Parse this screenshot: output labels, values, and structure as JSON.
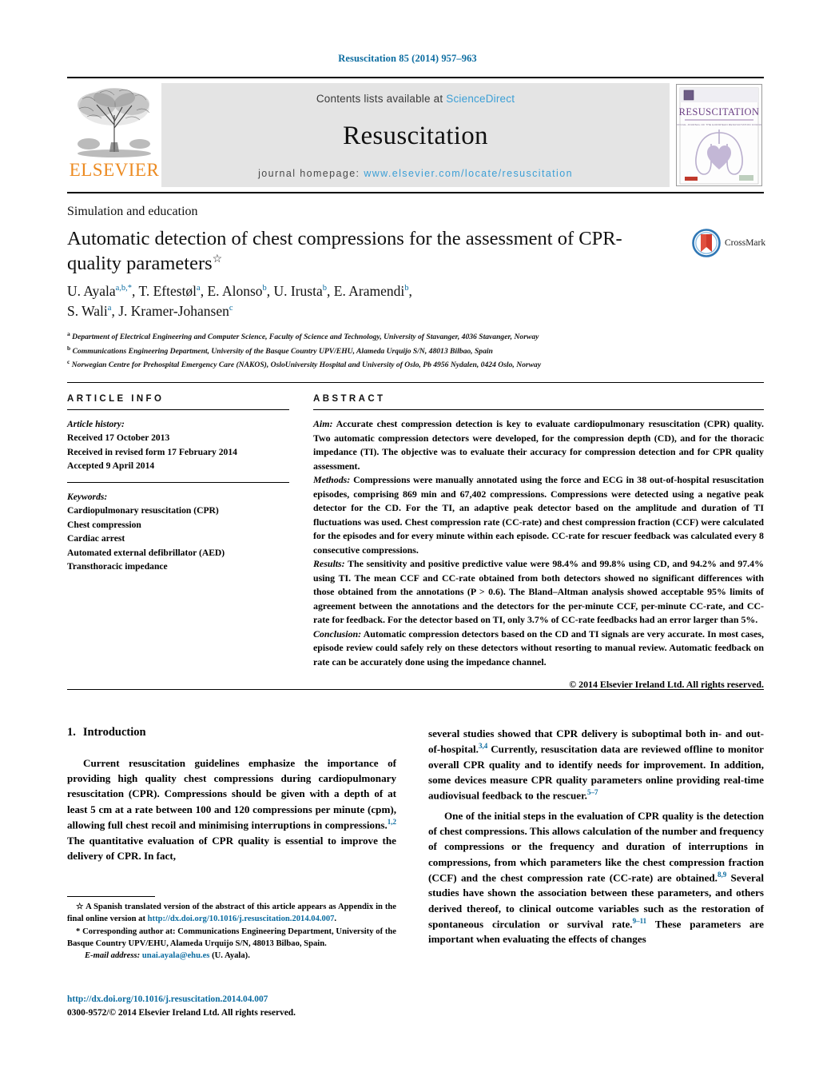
{
  "running_head": "Resuscitation 85 (2014) 957–963",
  "masthead": {
    "publisher_wordmark": "ELSEVIER",
    "contents_prefix": "Contents lists available at ",
    "contents_link": "ScienceDirect",
    "journal_name": "Resuscitation",
    "homepage_prefix": "journal homepage: ",
    "homepage_url": "www.elsevier.com/locate/resuscitation",
    "cover_title": "RESUSCITATION",
    "cover_subtitle": "OFFICIAL JOURNAL OF THE EUROPEAN RESUSCITATION COUNCIL",
    "link_color": "#3c9fd6",
    "band_color": "#e4e4e4",
    "elsevier_orange": "#ec8b22"
  },
  "article": {
    "section_label": "Simulation and education",
    "title": "Automatic detection of chest compressions for the assessment of CPR-quality parameters",
    "title_marker": "☆",
    "crossmark_label": "CrossMark",
    "authors_line1": "U. Ayala",
    "authors": [
      {
        "name": "U. Ayala",
        "sup": "a,b,*"
      },
      {
        "name": "T. Eftestøl",
        "sup": "a"
      },
      {
        "name": "E. Alonso",
        "sup": "b"
      },
      {
        "name": "U. Irusta",
        "sup": "b"
      },
      {
        "name": "E. Aramendi",
        "sup": "b"
      },
      {
        "name": "S. Wali",
        "sup": "a"
      },
      {
        "name": "J. Kramer-Johansen",
        "sup": "c"
      }
    ],
    "affiliations": [
      {
        "mark": "a",
        "text": "Department of Electrical Engineering and Computer Science, Faculty of Science and Technology, University of Stavanger, 4036 Stavanger, Norway"
      },
      {
        "mark": "b",
        "text": "Communications Engineering Department, University of the Basque Country UPV/EHU, Alameda Urquijo S/N, 48013 Bilbao, Spain"
      },
      {
        "mark": "c",
        "text": "Norwegian Centre for Prehospital Emergency Care (NAKOS), OsloUniversity Hospital and University of Oslo, Pb 4956 Nydalen, 0424 Oslo, Norway"
      }
    ]
  },
  "article_info": {
    "heading": "ARTICLE INFO",
    "history_title": "Article history:",
    "history": [
      "Received 17 October 2013",
      "Received in revised form 17 February 2014",
      "Accepted 9 April 2014"
    ],
    "keywords_title": "Keywords:",
    "keywords": [
      "Cardiopulmonary resuscitation (CPR)",
      "Chest compression",
      "Cardiac arrest",
      "Automated external defibrillator (AED)",
      "Transthoracic impedance"
    ]
  },
  "abstract": {
    "heading": "ABSTRACT",
    "sections": [
      {
        "lead": "Aim:",
        "text": " Accurate chest compression detection is key to evaluate cardiopulmonary resuscitation (CPR) quality. Two automatic compression detectors were developed, for the compression depth (CD), and for the thoracic impedance (TI). The objective was to evaluate their accuracy for compression detection and for CPR quality assessment."
      },
      {
        "lead": "Methods:",
        "text": " Compressions were manually annotated using the force and ECG in 38 out-of-hospital resuscitation episodes, comprising 869 min and 67,402 compressions. Compressions were detected using a negative peak detector for the CD. For the TI, an adaptive peak detector based on the amplitude and duration of TI fluctuations was used. Chest compression rate (CC-rate) and chest compression fraction (CCF) were calculated for the episodes and for every minute within each episode. CC-rate for rescuer feedback was calculated every 8 consecutive compressions."
      },
      {
        "lead": "Results:",
        "text": " The sensitivity and positive predictive value were 98.4% and 99.8% using CD, and 94.2% and 97.4% using TI. The mean CCF and CC-rate obtained from both detectors showed no significant differences with those obtained from the annotations (P > 0.6). The Bland–Altman analysis showed acceptable 95% limits of agreement between the annotations and the detectors for the per-minute CCF, per-minute CC-rate, and CC-rate for feedback. For the detector based on TI, only 3.7% of CC-rate feedbacks had an error larger than 5%."
      },
      {
        "lead": "Conclusion:",
        "text": " Automatic compression detectors based on the CD and TI signals are very accurate. In most cases, episode review could safely rely on these detectors without resorting to manual review. Automatic feedback on rate can be accurately done using the impedance channel."
      }
    ],
    "copyright": "© 2014 Elsevier Ireland Ltd. All rights reserved."
  },
  "body": {
    "section_number": "1.",
    "section_title": "Introduction",
    "left_paragraphs": [
      "Current resuscitation guidelines emphasize the importance of providing high quality chest compressions during cardiopulmonary resuscitation (CPR). Compressions should be given with a depth of at least 5 cm at a rate between 100 and 120 compressions per minute (cpm), allowing full chest recoil and minimising interruptions in compressions.",
      " The quantitative evaluation of CPR quality is essential to improve the delivery of CPR. In fact,"
    ],
    "left_ref_1": "1,2",
    "right_paragraphs": [
      "several studies showed that CPR delivery is suboptimal both in- and out-of-hospital.",
      " Currently, resuscitation data are reviewed offline to monitor overall CPR quality and to identify needs for improvement. In addition, some devices measure CPR quality parameters online providing real-time audiovisual feedback to the rescuer.",
      "One of the initial steps in the evaluation of CPR quality is the detection of chest compressions. This allows calculation of the number and frequency of compressions or the frequency and duration of interruptions in compressions, from which parameters like the chest compression fraction (CCF) and the chest compression rate (CC-rate) are obtained.",
      " Several studies have shown the association between these parameters, and others derived thereof, to clinical outcome variables such as the restoration of spontaneous circulation or survival rate.",
      " These parameters are important when evaluating the effects of changes"
    ],
    "right_ref_1": "3,4",
    "right_ref_2": "5–7",
    "right_ref_3": "8,9",
    "right_ref_4": "9–11"
  },
  "footnotes": {
    "star_marker": "☆",
    "star_text_1": " A Spanish translated version of the abstract of this article appears as Appendix in the final online version at ",
    "star_link": "http://dx.doi.org/10.1016/j.resuscitation.2014.04.007",
    "star_text_2": ".",
    "corr_marker": "*",
    "corr_text": " Corresponding author at: Communications Engineering Department, University of the Basque Country UPV/EHU, Alameda Urquijo S/N, 48013 Bilbao, Spain.",
    "email_label": "E-mail address:",
    "email_link": "unai.ayala@ehu.es",
    "email_suffix": " (U. Ayala)."
  },
  "footer": {
    "doi_url": "http://dx.doi.org/10.1016/j.resuscitation.2014.04.007",
    "issn_line": "0300-9572/© 2014 Elsevier Ireland Ltd. All rights reserved."
  }
}
